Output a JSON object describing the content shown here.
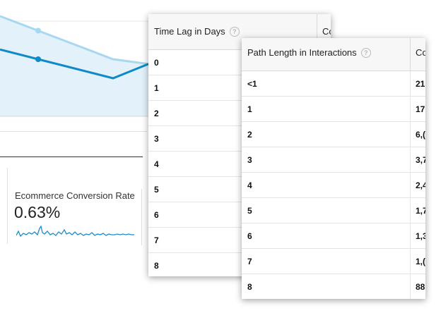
{
  "chart_data": {
    "type": "line",
    "series": [
      {
        "values": [
          null,
          0.9,
          0.6,
          0.55
        ]
      },
      {
        "values": [
          null,
          0.6,
          0.4,
          0.55
        ]
      }
    ],
    "colors": {
      "line_light": "#a8d8f0",
      "line_dark": "#0e8ac8",
      "fill": "#e3f1fa"
    }
  },
  "metric": {
    "label": "Ecommerce Conversion Rate",
    "value": "0.63%",
    "sparkline_color": "#1a8ccc"
  },
  "time_lag_table": {
    "header": "Time Lag in Days",
    "second_header": "Co",
    "rows": [
      "0",
      "1",
      "2",
      "3",
      "4",
      "5",
      "6",
      "7",
      "8"
    ]
  },
  "path_length_table": {
    "header": "Path Length in Interactions",
    "second_header": "Co",
    "rows": [
      {
        "label": "<1",
        "value": "21"
      },
      {
        "label": "1",
        "value": "17"
      },
      {
        "label": "2",
        "value": "6,("
      },
      {
        "label": "3",
        "value": "3,7"
      },
      {
        "label": "4",
        "value": "2,4"
      },
      {
        "label": "5",
        "value": "1,7"
      },
      {
        "label": "6",
        "value": "1,3"
      },
      {
        "label": "7",
        "value": "1,("
      },
      {
        "label": "8",
        "value": "88"
      }
    ]
  }
}
